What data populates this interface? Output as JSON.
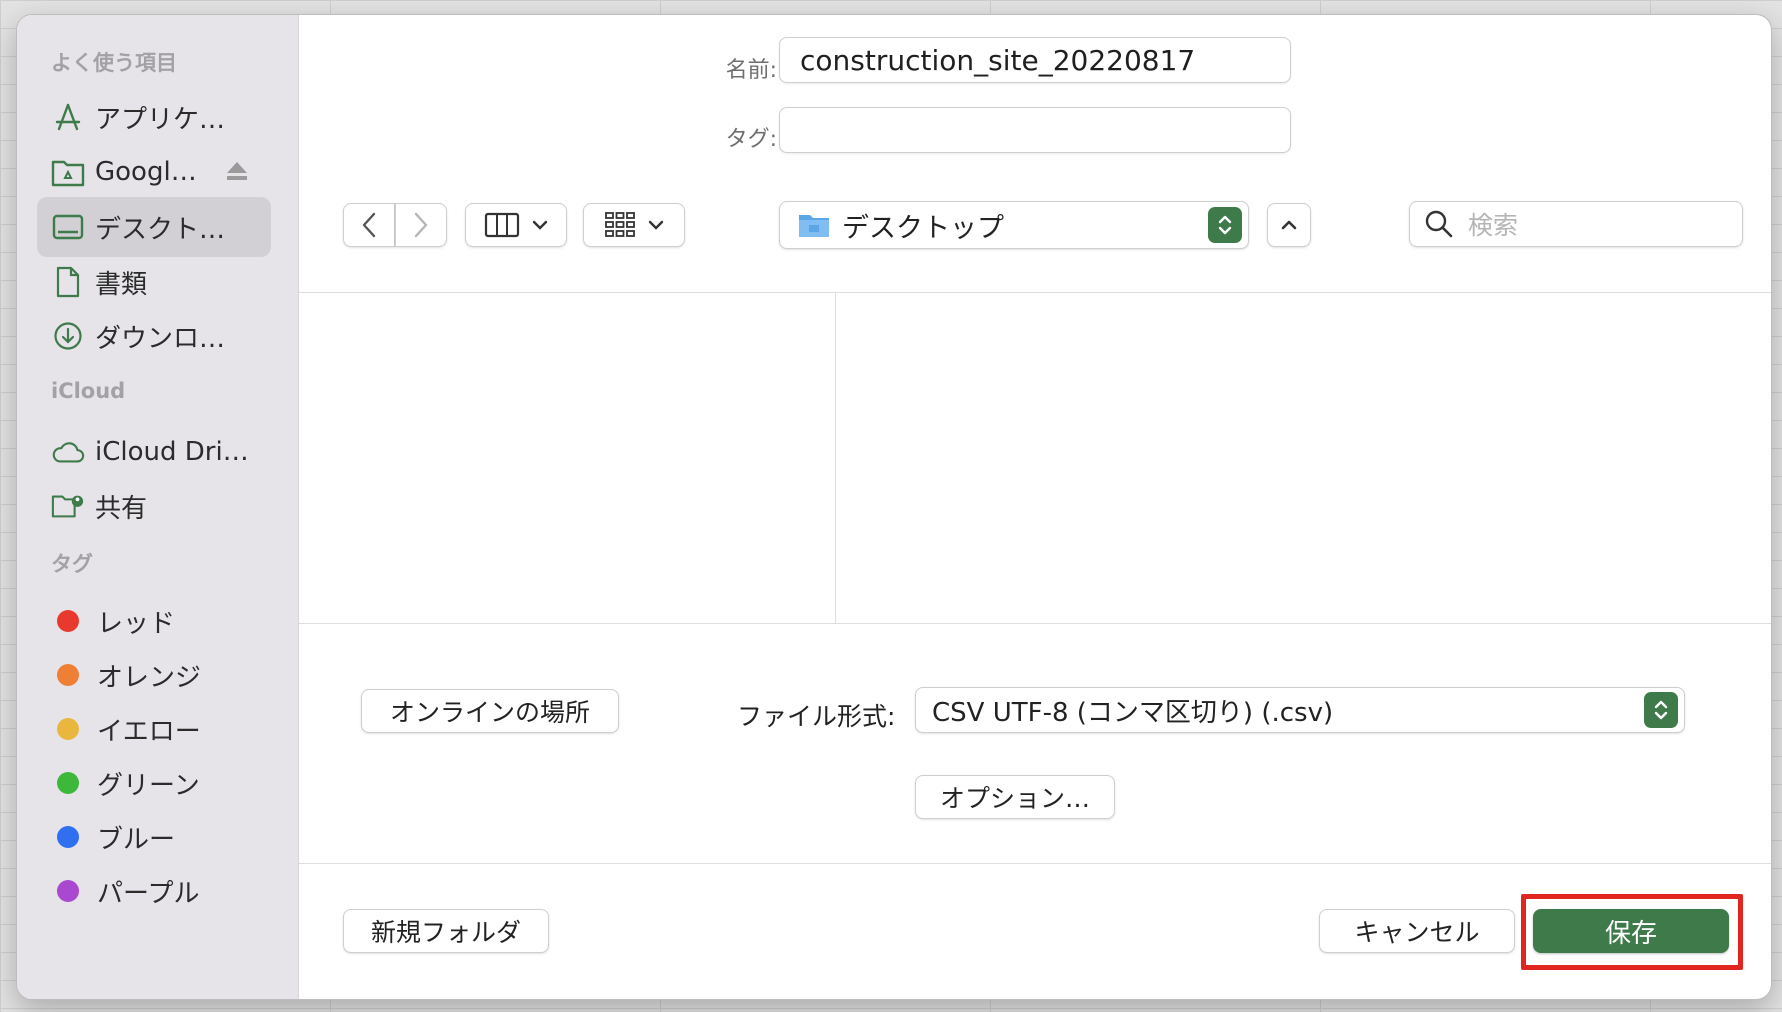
{
  "sidebar": {
    "favorites_title": "よく使う項目",
    "favorites": [
      {
        "label": "アプリケ…",
        "icon": "applications-icon"
      },
      {
        "label": "Googl…",
        "icon": "google-drive-folder-icon"
      },
      {
        "label": "デスクト…",
        "icon": "desktop-icon"
      },
      {
        "label": "書類",
        "icon": "document-icon"
      },
      {
        "label": "ダウンロ…",
        "icon": "download-icon"
      }
    ],
    "icloud_title": "iCloud",
    "icloud": [
      {
        "label": "iCloud Dri…",
        "icon": "icloud-icon"
      },
      {
        "label": "共有",
        "icon": "shared-folder-icon"
      }
    ],
    "tags_title": "タグ",
    "tags": [
      {
        "label": "レッド",
        "color": "#e8392f"
      },
      {
        "label": "オレンジ",
        "color": "#ee7f34"
      },
      {
        "label": "イエロー",
        "color": "#e9b73d"
      },
      {
        "label": "グリーン",
        "color": "#3db83a"
      },
      {
        "label": "ブルー",
        "color": "#2f6ff0"
      },
      {
        "label": "パープル",
        "color": "#a849d0"
      }
    ]
  },
  "top": {
    "name_label": "名前:",
    "name_value": "construction_site_20220817",
    "tags_label": "タグ:",
    "tags_value": ""
  },
  "toolbar": {
    "location": "デスクトップ",
    "search_placeholder": "検索"
  },
  "format": {
    "online_locations": "オンラインの場所",
    "label": "ファイル形式:",
    "value": "CSV UTF-8 (コンマ区切り) (.csv)",
    "options": "オプション…"
  },
  "footer": {
    "new_folder": "新規フォルダ",
    "cancel": "キャンセル",
    "save": "保存"
  },
  "colors": {
    "accent": "#3f7a4b",
    "highlight": "#e0261f"
  }
}
